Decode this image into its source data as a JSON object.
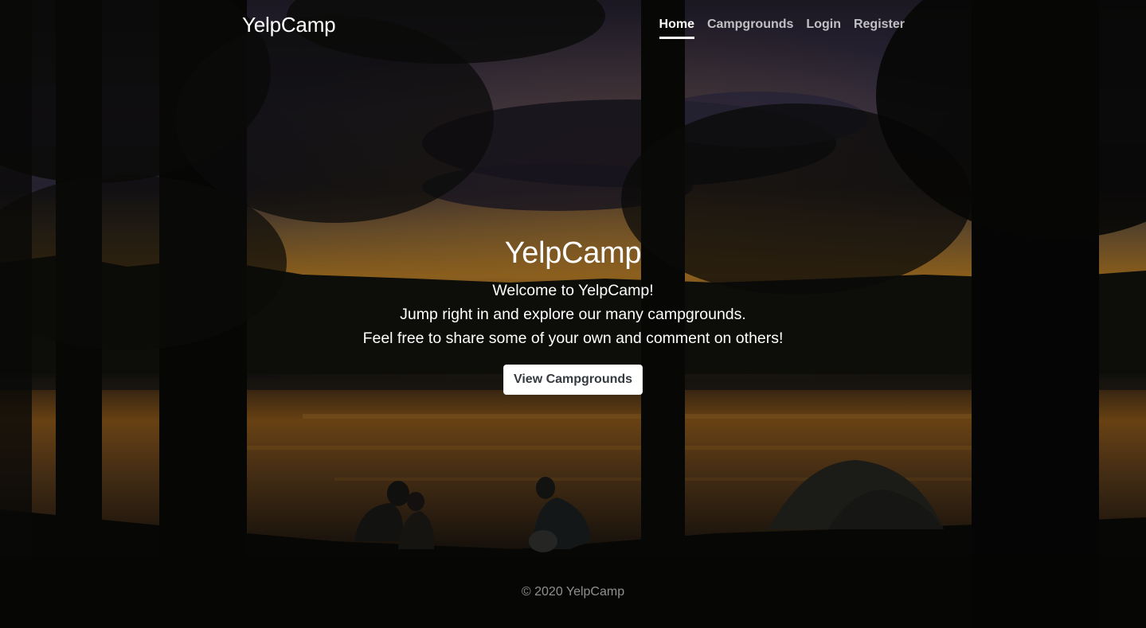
{
  "header": {
    "brand": "YelpCamp",
    "nav": [
      {
        "label": "Home",
        "active": true
      },
      {
        "label": "Campgrounds",
        "active": false
      },
      {
        "label": "Login",
        "active": false
      },
      {
        "label": "Register",
        "active": false
      }
    ]
  },
  "hero": {
    "title": "YelpCamp",
    "lines": [
      "Welcome to YelpCamp!",
      "Jump right in and explore our many campgrounds.",
      "Feel free to share some of your own and comment on others!"
    ],
    "cta_label": "View Campgrounds"
  },
  "footer": {
    "copyright": "© 2020 YelpCamp"
  },
  "colors": {
    "sky_top": "#3d3550",
    "sunset": "#c9861f",
    "accent_text": "#ffffff",
    "button_text": "#343a40"
  }
}
